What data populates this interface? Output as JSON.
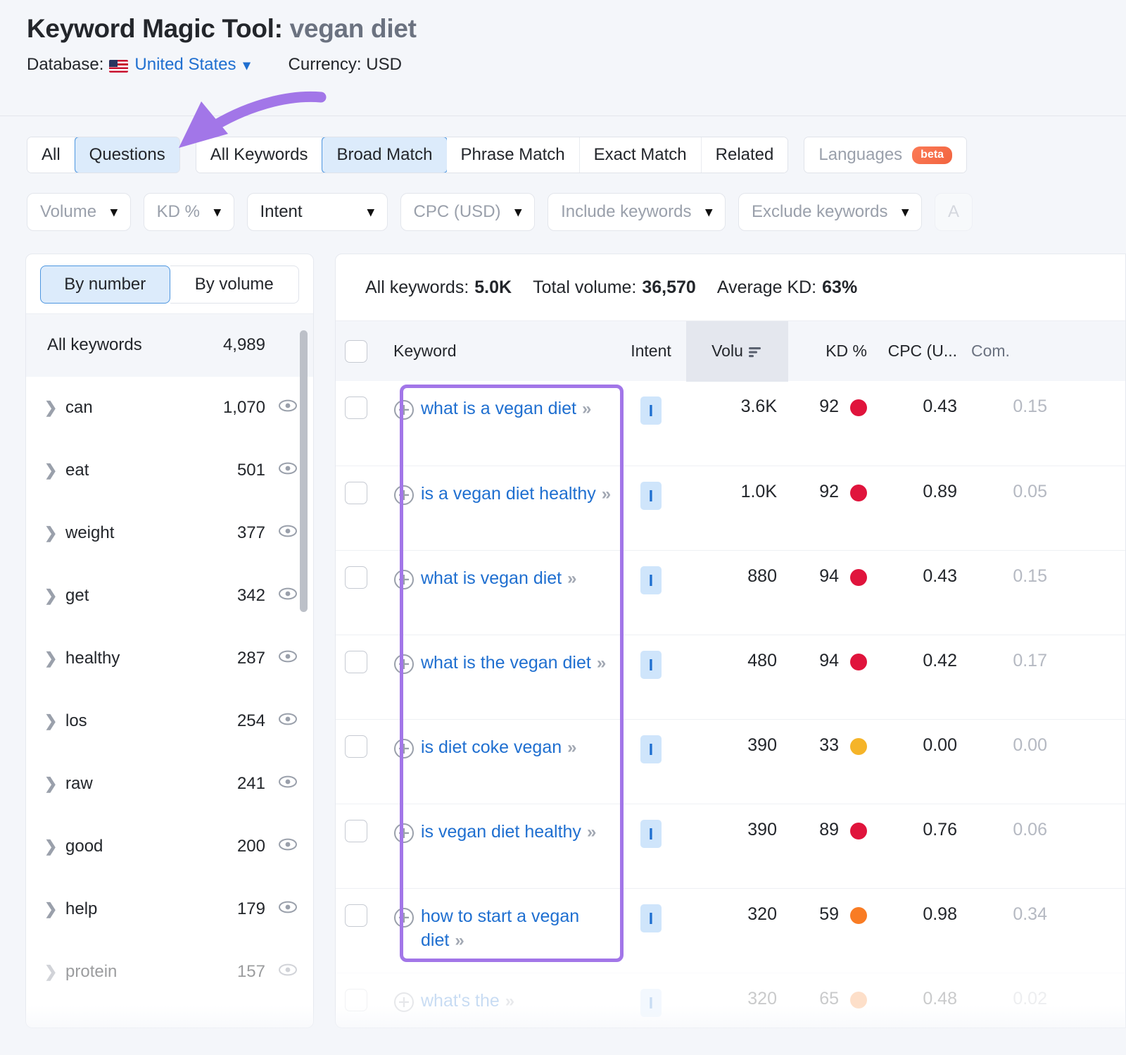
{
  "header": {
    "title_prefix": "Keyword Magic Tool:",
    "query": "vegan diet",
    "database_label": "Database:",
    "database_value": "United States",
    "currency": "Currency: USD",
    "caret_icon": "chevron-down-icon",
    "flag_icon": "us-flag-icon"
  },
  "tabs": {
    "group1": [
      {
        "label": "All",
        "active": false
      },
      {
        "label": "Questions",
        "active": true
      }
    ],
    "group2": [
      {
        "label": "All Keywords",
        "active": false
      },
      {
        "label": "Broad Match",
        "active": true
      },
      {
        "label": "Phrase Match",
        "active": false
      },
      {
        "label": "Exact Match",
        "active": false
      },
      {
        "label": "Related",
        "active": false
      }
    ],
    "group3": [
      {
        "label": "Languages",
        "badge": "beta",
        "active": false
      }
    ]
  },
  "filters": [
    {
      "label": "Volume",
      "muted": true
    },
    {
      "label": "KD %",
      "muted": true
    },
    {
      "label": "Intent",
      "muted": false
    },
    {
      "label": "CPC (USD)",
      "muted": true
    },
    {
      "label": "Include keywords",
      "muted": true
    },
    {
      "label": "Exclude keywords",
      "muted": true
    },
    {
      "label": "A",
      "muted": true
    }
  ],
  "sidebar": {
    "toggle": [
      {
        "label": "By number",
        "active": true
      },
      {
        "label": "By volume",
        "active": false
      }
    ],
    "header_row": {
      "name": "All keywords",
      "count": "4,989"
    },
    "items": [
      {
        "name": "can",
        "count": "1,070",
        "faded": false
      },
      {
        "name": "eat",
        "count": "501",
        "faded": false
      },
      {
        "name": "weight",
        "count": "377",
        "faded": false
      },
      {
        "name": "get",
        "count": "342",
        "faded": false
      },
      {
        "name": "healthy",
        "count": "287",
        "faded": false
      },
      {
        "name": "los",
        "count": "254",
        "faded": false
      },
      {
        "name": "raw",
        "count": "241",
        "faded": false
      },
      {
        "name": "good",
        "count": "200",
        "faded": false
      },
      {
        "name": "help",
        "count": "179",
        "faded": false
      },
      {
        "name": "protein",
        "count": "157",
        "faded": true
      }
    ]
  },
  "summary": {
    "all_keywords_label": "All keywords:",
    "all_keywords_value": "5.0K",
    "total_volume_label": "Total volume:",
    "total_volume_value": "36,570",
    "average_kd_label": "Average KD:",
    "average_kd_value": "63%"
  },
  "table": {
    "columns": [
      {
        "key": "keyword",
        "label": "Keyword"
      },
      {
        "key": "intent",
        "label": "Intent"
      },
      {
        "key": "volume",
        "label": "Volu",
        "sorted": true,
        "sort_icon": "sort-descending-icon"
      },
      {
        "key": "kd",
        "label": "KD %"
      },
      {
        "key": "cpc",
        "label": "CPC (U..."
      },
      {
        "key": "com",
        "label": "Com."
      }
    ],
    "rows": [
      {
        "keyword": "what is a vegan diet",
        "intent": "I",
        "volume": "3.6K",
        "kd": "92",
        "kd_color": "#e0143c",
        "cpc": "0.43",
        "com": "0.15",
        "faded": false
      },
      {
        "keyword": "is a vegan diet healthy",
        "intent": "I",
        "volume": "1.0K",
        "kd": "92",
        "kd_color": "#e0143c",
        "cpc": "0.89",
        "com": "0.05",
        "faded": false
      },
      {
        "keyword": "what is vegan diet",
        "intent": "I",
        "volume": "880",
        "kd": "94",
        "kd_color": "#e0143c",
        "cpc": "0.43",
        "com": "0.15",
        "faded": false
      },
      {
        "keyword": "what is the vegan diet",
        "intent": "I",
        "volume": "480",
        "kd": "94",
        "kd_color": "#e0143c",
        "cpc": "0.42",
        "com": "0.17",
        "faded": false
      },
      {
        "keyword": "is diet coke vegan",
        "intent": "I",
        "volume": "390",
        "kd": "33",
        "kd_color": "#f5b429",
        "cpc": "0.00",
        "com": "0.00",
        "faded": false
      },
      {
        "keyword": "is vegan diet healthy",
        "intent": "I",
        "volume": "390",
        "kd": "89",
        "kd_color": "#e0143c",
        "cpc": "0.76",
        "com": "0.06",
        "faded": false
      },
      {
        "keyword": "how to start a vegan diet",
        "intent": "I",
        "volume": "320",
        "kd": "59",
        "kd_color": "#f97c24",
        "cpc": "0.98",
        "com": "0.34",
        "faded": false
      },
      {
        "keyword": "what's the",
        "intent": "I",
        "volume": "320",
        "kd": "65",
        "kd_color": "#f97c24",
        "cpc": "0.48",
        "com": "0.02",
        "faded": true
      }
    ]
  },
  "annotations": {
    "arrow": {
      "name": "purple-arrow-annotation",
      "color": "#a276e8",
      "points_to": "Questions"
    },
    "highlight": {
      "name": "purple-highlight-box",
      "color": "#a276e8",
      "covers": "keyword-column-rows"
    }
  }
}
